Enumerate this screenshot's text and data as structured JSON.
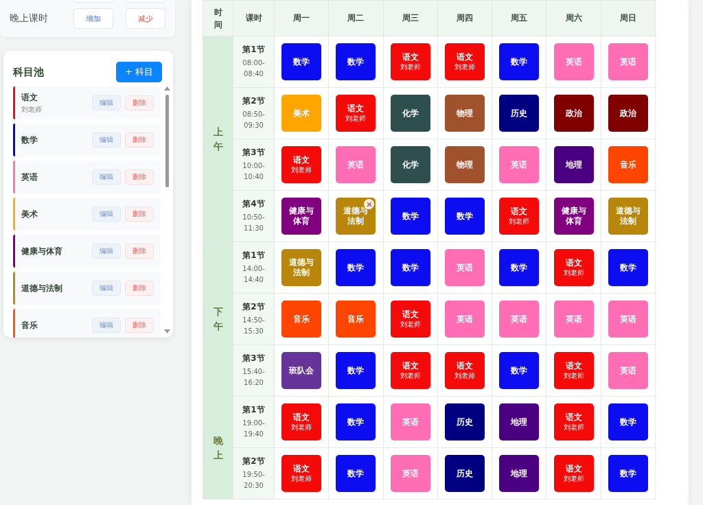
{
  "evening_setting": {
    "label": "晚上课时",
    "buttons": [
      "增加",
      "减少"
    ]
  },
  "subject_pool": {
    "title": "科目池",
    "add_button": "+ 科目",
    "items": [
      {
        "name": "语文",
        "teacher": "刘老师",
        "color": "#e0102a",
        "edit": "编辑",
        "delete": "删除"
      },
      {
        "name": "数学",
        "color": "#0a0ab0",
        "edit": "编辑",
        "delete": "删除"
      },
      {
        "name": "英语",
        "color": "#f07ab8",
        "edit": "编辑",
        "delete": "删除"
      },
      {
        "name": "美术",
        "color": "#f0b020",
        "edit": "编辑",
        "delete": "删除"
      },
      {
        "name": "健康与体育",
        "color": "#800080",
        "edit": "编辑",
        "delete": "删除"
      },
      {
        "name": "道德与法制",
        "color": "#b08a2a",
        "edit": "编辑",
        "delete": "删除"
      },
      {
        "name": "音乐",
        "color": "#f05a20",
        "edit": "编辑",
        "delete": "删除"
      }
    ]
  },
  "timetable": {
    "columns": [
      "时间",
      "课时",
      "周一",
      "周二",
      "周三",
      "周四",
      "周五",
      "周六",
      "周日"
    ],
    "sections": [
      {
        "name": "上午",
        "periods": [
          {
            "label": "第1节",
            "time": "08:00-08:40",
            "cells": [
              {
                "subject": "数学",
                "color": "#0d0df2",
                "hovered": false
              },
              {
                "subject": "数学",
                "color": "#0d0df2",
                "hovered": false
              },
              {
                "subject": "语文",
                "teacher": "刘老师",
                "color": "#f50a0a",
                "hovered": false
              },
              {
                "subject": "语文",
                "teacher": "刘老师",
                "color": "#f50a0a",
                "hovered": false
              },
              {
                "subject": "数学",
                "color": "#0d0df2",
                "hovered": false
              },
              {
                "subject": "英语",
                "color": "#ff6eb4",
                "hovered": false
              },
              {
                "subject": "英语",
                "color": "#ff6eb4",
                "hovered": false
              }
            ]
          },
          {
            "label": "第2节",
            "time": "08:50-09:30",
            "cells": [
              {
                "subject": "美术",
                "color": "#ffa500",
                "hovered": false
              },
              {
                "subject": "语文",
                "teacher": "刘老师",
                "color": "#f50a0a",
                "hovered": false
              },
              {
                "subject": "化学",
                "color": "#2f4f4f",
                "hovered": false
              },
              {
                "subject": "物理",
                "color": "#a0522d",
                "hovered": false
              },
              {
                "subject": "历史",
                "color": "#000080",
                "hovered": false
              },
              {
                "subject": "政治",
                "color": "#800000",
                "hovered": false
              },
              {
                "subject": "政治",
                "color": "#800000",
                "hovered": false
              }
            ]
          },
          {
            "label": "第3节",
            "time": "10:00-10:40",
            "cells": [
              {
                "subject": "语文",
                "teacher": "刘老师",
                "color": "#f50a0a",
                "hovered": false
              },
              {
                "subject": "英语",
                "color": "#ff6eb4",
                "hovered": false
              },
              {
                "subject": "化学",
                "color": "#2f4f4f",
                "hovered": false
              },
              {
                "subject": "物理",
                "color": "#a0522d",
                "hovered": false
              },
              {
                "subject": "英语",
                "color": "#ff6eb4",
                "hovered": false
              },
              {
                "subject": "地理",
                "color": "#4b0082",
                "hovered": false
              },
              {
                "subject": "音乐",
                "color": "#ff4500",
                "hovered": false
              }
            ]
          },
          {
            "label": "第4节",
            "time": "10:50-11:30",
            "cells": [
              {
                "subject": "健康与体育",
                "color": "#800080",
                "hovered": false
              },
              {
                "subject": "道德与法制",
                "color": "#b8860b",
                "hovered": true
              },
              {
                "subject": "数学",
                "color": "#0d0df2",
                "hovered": false
              },
              {
                "subject": "数学",
                "color": "#0d0df2",
                "hovered": false
              },
              {
                "subject": "语文",
                "teacher": "刘老师",
                "color": "#f50a0a",
                "hovered": false
              },
              {
                "subject": "健康与体育",
                "color": "#800080",
                "hovered": false
              },
              {
                "subject": "道德与法制",
                "color": "#b8860b",
                "hovered": false
              }
            ]
          }
        ]
      },
      {
        "name": "下午",
        "periods": [
          {
            "label": "第1节",
            "time": "14:00-14:40",
            "cells": [
              {
                "subject": "道德与法制",
                "color": "#b8860b",
                "hovered": false
              },
              {
                "subject": "数学",
                "color": "#0d0df2",
                "hovered": false
              },
              {
                "subject": "数学",
                "color": "#0d0df2",
                "hovered": false
              },
              {
                "subject": "英语",
                "color": "#ff6eb4",
                "hovered": false
              },
              {
                "subject": "数学",
                "color": "#0d0df2",
                "hovered": false
              },
              {
                "subject": "语文",
                "teacher": "刘老师",
                "color": "#f50a0a",
                "hovered": false
              },
              {
                "subject": "数学",
                "color": "#0d0df2",
                "hovered": false
              }
            ]
          },
          {
            "label": "第2节",
            "time": "14:50-15:30",
            "cells": [
              {
                "subject": "音乐",
                "color": "#ff4500",
                "hovered": false
              },
              {
                "subject": "音乐",
                "color": "#ff4500",
                "hovered": false
              },
              {
                "subject": "语文",
                "teacher": "刘老师",
                "color": "#f50a0a",
                "hovered": false
              },
              {
                "subject": "英语",
                "color": "#ff6eb4",
                "hovered": false
              },
              {
                "subject": "英语",
                "color": "#ff6eb4",
                "hovered": false
              },
              {
                "subject": "英语",
                "color": "#ff6eb4",
                "hovered": false
              },
              {
                "subject": "英语",
                "color": "#ff6eb4",
                "hovered": false
              }
            ]
          },
          {
            "label": "第3节",
            "time": "15:40-16:20",
            "cells": [
              {
                "subject": "班队会",
                "color": "#663399",
                "hovered": false
              },
              {
                "subject": "数学",
                "color": "#0d0df2",
                "hovered": false
              },
              {
                "subject": "语文",
                "teacher": "刘老师",
                "color": "#f50a0a",
                "hovered": false
              },
              {
                "subject": "语文",
                "teacher": "刘老师",
                "color": "#f50a0a",
                "hovered": false
              },
              {
                "subject": "数学",
                "color": "#0d0df2",
                "hovered": false
              },
              {
                "subject": "语文",
                "teacher": "刘老师",
                "color": "#f50a0a",
                "hovered": false
              },
              {
                "subject": "英语",
                "color": "#ff6eb4",
                "hovered": false
              }
            ]
          }
        ]
      },
      {
        "name": "晚上",
        "periods": [
          {
            "label": "第1节",
            "time": "19:00-19:40",
            "cells": [
              {
                "subject": "语文",
                "teacher": "刘老师",
                "color": "#f50a0a",
                "hovered": false
              },
              {
                "subject": "数学",
                "color": "#0d0df2",
                "hovered": false
              },
              {
                "subject": "英语",
                "color": "#ff6eb4",
                "hovered": false
              },
              {
                "subject": "历史",
                "color": "#000080",
                "hovered": false
              },
              {
                "subject": "地理",
                "color": "#4b0082",
                "hovered": false
              },
              {
                "subject": "语文",
                "teacher": "刘老师",
                "color": "#f50a0a",
                "hovered": false
              },
              {
                "subject": "数学",
                "color": "#0d0df2",
                "hovered": false
              }
            ]
          },
          {
            "label": "第2节",
            "time": "19:50-20:30",
            "cells": [
              {
                "subject": "语文",
                "teacher": "刘老师",
                "color": "#f50a0a",
                "hovered": false
              },
              {
                "subject": "数学",
                "color": "#0d0df2",
                "hovered": false
              },
              {
                "subject": "英语",
                "color": "#ff6eb4",
                "hovered": false
              },
              {
                "subject": "历史",
                "color": "#000080",
                "hovered": false
              },
              {
                "subject": "地理",
                "color": "#4b0082",
                "hovered": false
              },
              {
                "subject": "语文",
                "teacher": "刘老师",
                "color": "#f50a0a",
                "hovered": false
              },
              {
                "subject": "数学",
                "color": "#0d0df2",
                "hovered": false
              }
            ]
          }
        ]
      }
    ]
  }
}
